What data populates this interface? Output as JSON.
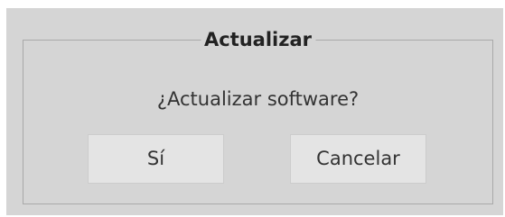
{
  "dialog": {
    "title": "Actualizar",
    "message": "¿Actualizar software?",
    "buttons": {
      "yes_label": "Sí",
      "cancel_label": "Cancelar"
    }
  },
  "colors": {
    "dialog_background": "#d5d5d5",
    "button_background": "#e4e4e4",
    "text": "#333333"
  }
}
